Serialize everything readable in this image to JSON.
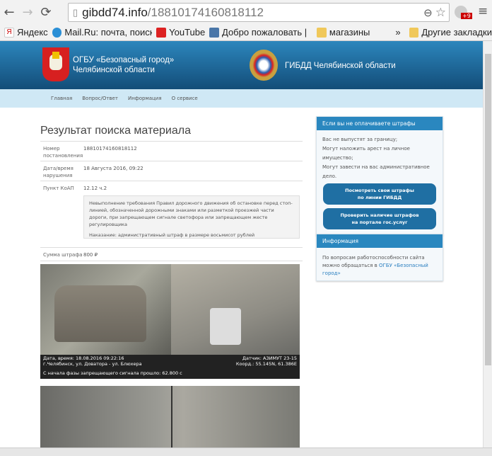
{
  "browser": {
    "url_domain": "gibdd74.info",
    "url_path": "/18810174160818112",
    "badge": "+9",
    "bookmarks": [
      "Яндекс",
      "Mail.Ru: почта, поиск",
      "YouTube",
      "Добро пожаловать |",
      "магазины",
      "»",
      "Другие закладки"
    ]
  },
  "header": {
    "org_left": "ОГБУ «Безопасный город» Челябинской области",
    "org_right": "ГИБДД Челябинской области"
  },
  "nav": [
    "Главная",
    "Вопрос/Ответ",
    "Информация",
    "О сервисе"
  ],
  "result": {
    "title": "Результат поиска материала",
    "rows": [
      {
        "k": "Номер постановления",
        "v": "18810174160818112"
      },
      {
        "k": "Дата/время нарушения",
        "v": "18 Августа 2016, 09:22"
      },
      {
        "k": "Пункт КоАП",
        "v": "12.12 ч.2"
      }
    ],
    "description": "Невыполнение требования Правил дорожного движения об остановке перед стоп-линией, обозначенной дорожными знаками или разметкой проезжей части дороги, при запрещающем сигнале светофора или запрещающем жесте регулировщика",
    "penalty": "Наказание: административный штраф в размере восьмисот рублей",
    "sum_label": "Сумма штрафа",
    "sum_value": "800 ₽"
  },
  "photo": {
    "line1_left": "Дата, время: 18.08.2016 09:22:16",
    "line2_left": "г.Челябинск, ул. Доватора - ул. Блюхера",
    "line1_right": "Датчик: АЗИМУТ 23-15",
    "line2_right": "Коорд.: 55.145N, 61.386E",
    "line3": "С начала фазы запрещающего сигнала прошло: 62.800 с"
  },
  "sidebar": {
    "warn_title": "Если вы не оплачиваете штрафы",
    "warn_items": [
      "Вас не выпустят за границу;",
      "Могут наложить арест на личное имущество;",
      "Могут завести на вас административное дело."
    ],
    "btn1_l1": "Посмотреть свои штрафы",
    "btn1_l2": "по линии ГИБДД",
    "btn2_l1": "Проверить наличие штрафов",
    "btn2_l2": "на портале гос.услуг",
    "info_title": "Информация",
    "info_text": "По вопросам работоспособности сайта можно обращаться в ",
    "info_link": "ОГБУ «Безопасный город»"
  }
}
